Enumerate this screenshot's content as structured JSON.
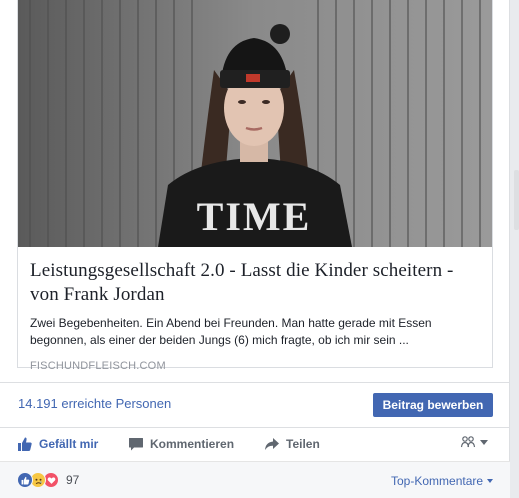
{
  "link_preview": {
    "title": "Leistungsgesellschaft 2.0 - Lasst die Kinder scheitern - von Frank Jordan",
    "description": "Zwei Begebenheiten. Ein Abend bei Freunden. Man hatte gerade mit Essen begonnen, als einer der beiden Jungs (6) mich fragte, ob ich mir sein ...",
    "domain": "FISCHUNDFLEISCH.COM",
    "image_icon": "photo-of-woman-in-beanie"
  },
  "reach": {
    "text": "14.191 erreichte Personen",
    "promote_label": "Beitrag bewerben"
  },
  "actions": {
    "like_label": "Gefällt mir",
    "comment_label": "Kommentieren",
    "share_label": "Teilen",
    "audience_icon": "friends-icon"
  },
  "summary": {
    "reaction_icons": [
      "like",
      "sad",
      "love"
    ],
    "reaction_count": "97",
    "sort_label": "Top-Kommentare"
  },
  "colors": {
    "accent": "#4267b2",
    "muted": "#606770",
    "love": "#f25268",
    "sad": "#f7c744"
  }
}
